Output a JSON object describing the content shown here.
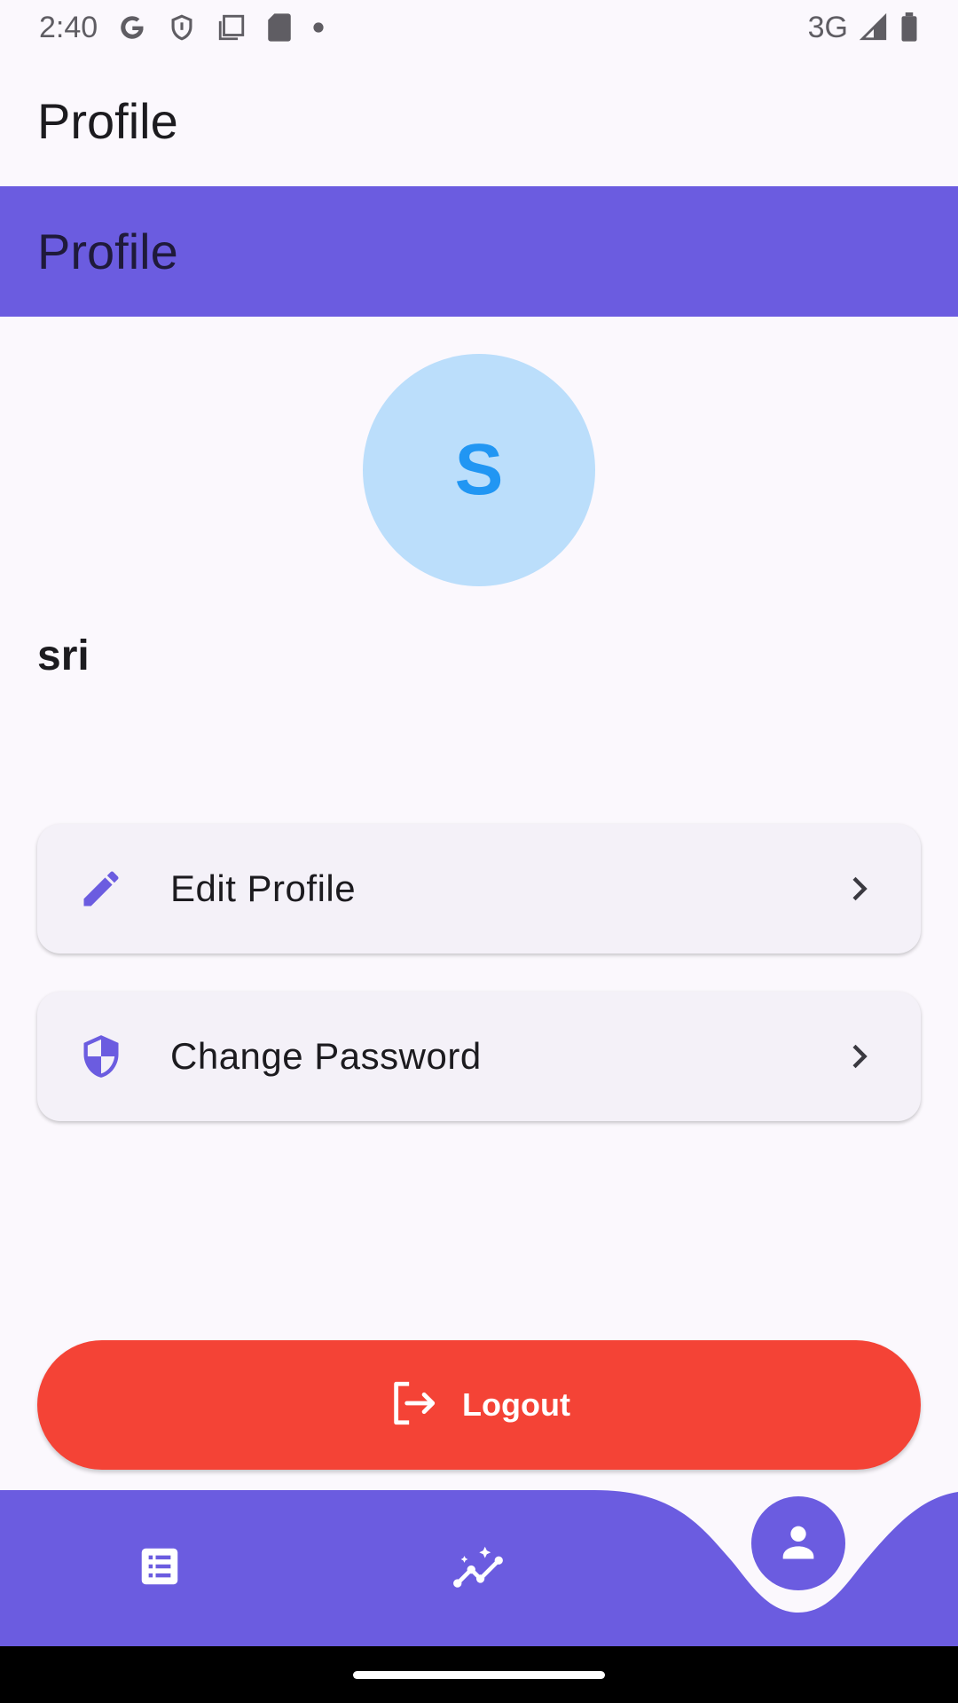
{
  "status_bar": {
    "time": "2:40",
    "network": "3G",
    "icons": [
      "google-icon",
      "shield-icon",
      "clipboard-icon",
      "sd-card-icon",
      "dot-icon",
      "signal-icon",
      "battery-icon"
    ]
  },
  "app_bar": {
    "title": "Profile"
  },
  "header": {
    "title": "Profile"
  },
  "profile": {
    "initial": "S",
    "name": "sri"
  },
  "menu": [
    {
      "label": "Edit Profile",
      "icon": "pencil-icon"
    },
    {
      "label": "Change Password",
      "icon": "security-shield-icon"
    }
  ],
  "logout": {
    "label": "Logout",
    "icon": "logout-icon"
  },
  "bottom_nav": {
    "items": [
      {
        "icon": "list-icon",
        "active": false
      },
      {
        "icon": "insights-icon",
        "active": false
      },
      {
        "icon": "person-icon",
        "active": true
      }
    ]
  },
  "colors": {
    "primary": "#6b5ce0",
    "avatar_bg": "#bbdefb",
    "avatar_text": "#2196f3",
    "danger": "#f44336",
    "background": "#fbf8fd",
    "card": "#f4f1f8"
  }
}
